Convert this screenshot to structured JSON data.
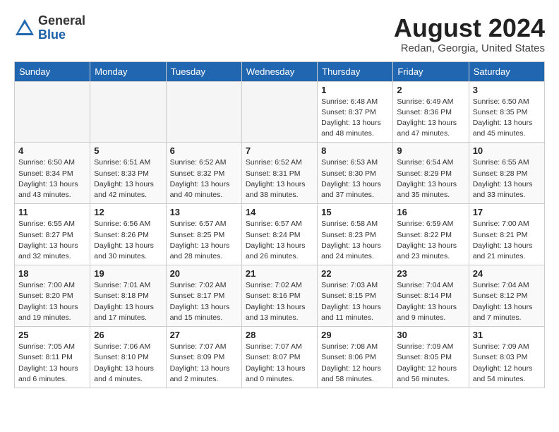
{
  "header": {
    "logo_general": "General",
    "logo_blue": "Blue",
    "title": "August 2024",
    "location": "Redan, Georgia, United States"
  },
  "weekdays": [
    "Sunday",
    "Monday",
    "Tuesday",
    "Wednesday",
    "Thursday",
    "Friday",
    "Saturday"
  ],
  "weeks": [
    [
      {
        "day": "",
        "empty": true
      },
      {
        "day": "",
        "empty": true
      },
      {
        "day": "",
        "empty": true
      },
      {
        "day": "",
        "empty": true
      },
      {
        "day": "1",
        "sunrise": "6:48 AM",
        "sunset": "8:37 PM",
        "daylight": "13 hours and 48 minutes."
      },
      {
        "day": "2",
        "sunrise": "6:49 AM",
        "sunset": "8:36 PM",
        "daylight": "13 hours and 47 minutes."
      },
      {
        "day": "3",
        "sunrise": "6:50 AM",
        "sunset": "8:35 PM",
        "daylight": "13 hours and 45 minutes."
      }
    ],
    [
      {
        "day": "4",
        "sunrise": "6:50 AM",
        "sunset": "8:34 PM",
        "daylight": "13 hours and 43 minutes."
      },
      {
        "day": "5",
        "sunrise": "6:51 AM",
        "sunset": "8:33 PM",
        "daylight": "13 hours and 42 minutes."
      },
      {
        "day": "6",
        "sunrise": "6:52 AM",
        "sunset": "8:32 PM",
        "daylight": "13 hours and 40 minutes."
      },
      {
        "day": "7",
        "sunrise": "6:52 AM",
        "sunset": "8:31 PM",
        "daylight": "13 hours and 38 minutes."
      },
      {
        "day": "8",
        "sunrise": "6:53 AM",
        "sunset": "8:30 PM",
        "daylight": "13 hours and 37 minutes."
      },
      {
        "day": "9",
        "sunrise": "6:54 AM",
        "sunset": "8:29 PM",
        "daylight": "13 hours and 35 minutes."
      },
      {
        "day": "10",
        "sunrise": "6:55 AM",
        "sunset": "8:28 PM",
        "daylight": "13 hours and 33 minutes."
      }
    ],
    [
      {
        "day": "11",
        "sunrise": "6:55 AM",
        "sunset": "8:27 PM",
        "daylight": "13 hours and 32 minutes."
      },
      {
        "day": "12",
        "sunrise": "6:56 AM",
        "sunset": "8:26 PM",
        "daylight": "13 hours and 30 minutes."
      },
      {
        "day": "13",
        "sunrise": "6:57 AM",
        "sunset": "8:25 PM",
        "daylight": "13 hours and 28 minutes."
      },
      {
        "day": "14",
        "sunrise": "6:57 AM",
        "sunset": "8:24 PM",
        "daylight": "13 hours and 26 minutes."
      },
      {
        "day": "15",
        "sunrise": "6:58 AM",
        "sunset": "8:23 PM",
        "daylight": "13 hours and 24 minutes."
      },
      {
        "day": "16",
        "sunrise": "6:59 AM",
        "sunset": "8:22 PM",
        "daylight": "13 hours and 23 minutes."
      },
      {
        "day": "17",
        "sunrise": "7:00 AM",
        "sunset": "8:21 PM",
        "daylight": "13 hours and 21 minutes."
      }
    ],
    [
      {
        "day": "18",
        "sunrise": "7:00 AM",
        "sunset": "8:20 PM",
        "daylight": "13 hours and 19 minutes."
      },
      {
        "day": "19",
        "sunrise": "7:01 AM",
        "sunset": "8:18 PM",
        "daylight": "13 hours and 17 minutes."
      },
      {
        "day": "20",
        "sunrise": "7:02 AM",
        "sunset": "8:17 PM",
        "daylight": "13 hours and 15 minutes."
      },
      {
        "day": "21",
        "sunrise": "7:02 AM",
        "sunset": "8:16 PM",
        "daylight": "13 hours and 13 minutes."
      },
      {
        "day": "22",
        "sunrise": "7:03 AM",
        "sunset": "8:15 PM",
        "daylight": "13 hours and 11 minutes."
      },
      {
        "day": "23",
        "sunrise": "7:04 AM",
        "sunset": "8:14 PM",
        "daylight": "13 hours and 9 minutes."
      },
      {
        "day": "24",
        "sunrise": "7:04 AM",
        "sunset": "8:12 PM",
        "daylight": "13 hours and 7 minutes."
      }
    ],
    [
      {
        "day": "25",
        "sunrise": "7:05 AM",
        "sunset": "8:11 PM",
        "daylight": "13 hours and 6 minutes."
      },
      {
        "day": "26",
        "sunrise": "7:06 AM",
        "sunset": "8:10 PM",
        "daylight": "13 hours and 4 minutes."
      },
      {
        "day": "27",
        "sunrise": "7:07 AM",
        "sunset": "8:09 PM",
        "daylight": "13 hours and 2 minutes."
      },
      {
        "day": "28",
        "sunrise": "7:07 AM",
        "sunset": "8:07 PM",
        "daylight": "13 hours and 0 minutes."
      },
      {
        "day": "29",
        "sunrise": "7:08 AM",
        "sunset": "8:06 PM",
        "daylight": "12 hours and 58 minutes."
      },
      {
        "day": "30",
        "sunrise": "7:09 AM",
        "sunset": "8:05 PM",
        "daylight": "12 hours and 56 minutes."
      },
      {
        "day": "31",
        "sunrise": "7:09 AM",
        "sunset": "8:03 PM",
        "daylight": "12 hours and 54 minutes."
      }
    ]
  ]
}
